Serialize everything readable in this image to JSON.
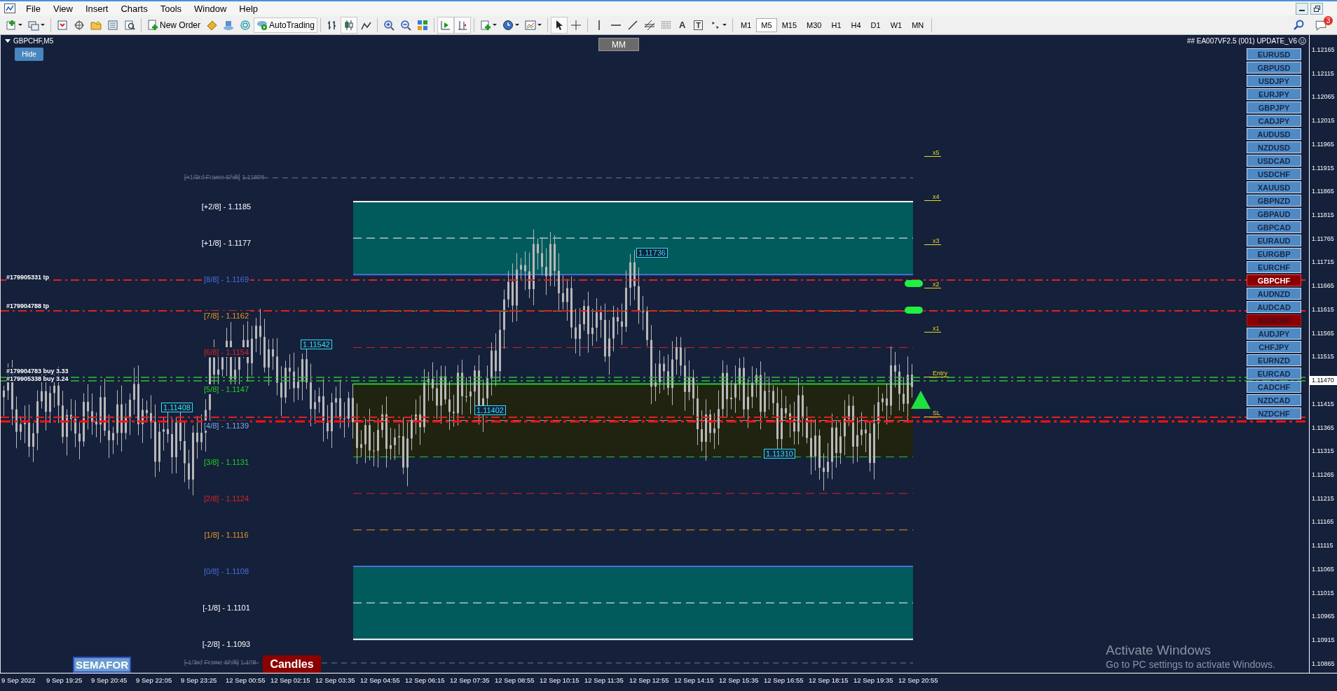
{
  "menu": [
    {
      "label": "File"
    },
    {
      "label": "View"
    },
    {
      "label": "Insert"
    },
    {
      "label": "Charts"
    },
    {
      "label": "Tools"
    },
    {
      "label": "Window"
    },
    {
      "label": "Help"
    }
  ],
  "toolbar": {
    "new_order": "New Order",
    "auto_trading": "AutoTrading",
    "text_tool": "A",
    "text_label_tool": "T",
    "notification_count": "3",
    "timeframes": [
      {
        "label": "M1",
        "selected": false
      },
      {
        "label": "M5",
        "selected": true
      },
      {
        "label": "M15",
        "selected": false
      },
      {
        "label": "M30",
        "selected": false
      },
      {
        "label": "H1",
        "selected": false
      },
      {
        "label": "H4",
        "selected": false
      },
      {
        "label": "D1",
        "selected": false
      },
      {
        "label": "W1",
        "selected": false
      },
      {
        "label": "MN",
        "selected": false
      }
    ]
  },
  "chart": {
    "symbol": "GBPCHF,M5",
    "hide_button": "Hide",
    "mm_button": "MM",
    "expert": "## EA007VF2.5 (001) UPDATE_V6",
    "frame_shift_top": "[+1/3rd Frame Shift]  1.11898",
    "frame_shift_bottom": "[-1/3rd Frame Shift]  1.108",
    "murrey_levels": [
      {
        "label": "[+2/8] - 1.1185",
        "color": "#ffffff"
      },
      {
        "label": "[+1/8] - 1.1177",
        "color": "#ffffff"
      },
      {
        "label": "[8/8] - 1.1169",
        "color": "#4a6fd8"
      },
      {
        "label": "[7/8] - 1.1162",
        "color": "#e69a1c"
      },
      {
        "label": "[6/8] - 1.1154",
        "color": "#e02020"
      },
      {
        "label": "[5/8] - 1.1147",
        "color": "#20d020"
      },
      {
        "label": "[4/8] - 1.1139",
        "color": "#7aa8e0"
      },
      {
        "label": "[3/8] - 1.1131",
        "color": "#20d020"
      },
      {
        "label": "[2/8] - 1.1124",
        "color": "#e02020"
      },
      {
        "label": "[1/8] - 1.1116",
        "color": "#e69a1c"
      },
      {
        "label": "[0/8] - 1.1108",
        "color": "#4a6fd8"
      },
      {
        "label": "[-1/8] - 1.1101",
        "color": "#ffffff"
      },
      {
        "label": "[-2/8] - 1.1093",
        "color": "#ffffff"
      }
    ],
    "order_labels": [
      {
        "label": "#179905331 tp"
      },
      {
        "label": "#179904788 tp"
      },
      {
        "label": "#179904783 buy 3.33"
      },
      {
        "label": "#179905338 buy 3.24"
      }
    ],
    "price_tags": [
      {
        "label": "1.11736"
      },
      {
        "label": "1.11542"
      },
      {
        "label": "1.11408"
      },
      {
        "label": "1.11402"
      },
      {
        "label": "1.11310"
      }
    ],
    "targets": [
      {
        "label": "x5"
      },
      {
        "label": "x4"
      },
      {
        "label": "x3"
      },
      {
        "label": "x2"
      },
      {
        "label": "x1"
      },
      {
        "label": "Entry"
      },
      {
        "label": "SL"
      }
    ],
    "semafor_button": "SEMAFOR",
    "candles_button": "Candles"
  },
  "symbols": [
    {
      "label": "EURUSD",
      "selected": false,
      "marked": false
    },
    {
      "label": "GBPUSD",
      "selected": false,
      "marked": false
    },
    {
      "label": "USDJPY",
      "selected": false,
      "marked": false
    },
    {
      "label": "EURJPY",
      "selected": false,
      "marked": false
    },
    {
      "label": "GBPJPY",
      "selected": false,
      "marked": false
    },
    {
      "label": "CADJPY",
      "selected": false,
      "marked": false
    },
    {
      "label": "AUDUSD",
      "selected": false,
      "marked": false
    },
    {
      "label": "NZDUSD",
      "selected": false,
      "marked": false
    },
    {
      "label": "USDCAD",
      "selected": false,
      "marked": false
    },
    {
      "label": "USDCHF",
      "selected": false,
      "marked": false
    },
    {
      "label": "XAUUSD",
      "selected": false,
      "marked": false
    },
    {
      "label": "GBPNZD",
      "selected": false,
      "marked": false
    },
    {
      "label": "GBPAUD",
      "selected": false,
      "marked": false
    },
    {
      "label": "GBPCAD",
      "selected": false,
      "marked": false
    },
    {
      "label": "EURAUD",
      "selected": false,
      "marked": false
    },
    {
      "label": "EURGBP",
      "selected": false,
      "marked": false
    },
    {
      "label": "EURCHF",
      "selected": false,
      "marked": false
    },
    {
      "label": "GBPCHF",
      "selected": true,
      "marked": false
    },
    {
      "label": "AUDNZD",
      "selected": false,
      "marked": false
    },
    {
      "label": "AUDCAD",
      "selected": false,
      "marked": false
    },
    {
      "label": "AUDCHF",
      "selected": false,
      "marked": true
    },
    {
      "label": "AUDJPY",
      "selected": false,
      "marked": false
    },
    {
      "label": "CHFJPY",
      "selected": false,
      "marked": false
    },
    {
      "label": "EURNZD",
      "selected": false,
      "marked": false
    },
    {
      "label": "EURCAD",
      "selected": false,
      "marked": false
    },
    {
      "label": "CADCHF",
      "selected": false,
      "marked": false
    },
    {
      "label": "NZDCAD",
      "selected": false,
      "marked": false
    },
    {
      "label": "NZDCHF",
      "selected": false,
      "marked": false
    }
  ],
  "price_axis": [
    {
      "label": "1.12165",
      "current": false
    },
    {
      "label": "1.12115",
      "current": false
    },
    {
      "label": "1.12065",
      "current": false
    },
    {
      "label": "1.12015",
      "current": false
    },
    {
      "label": "1.11965",
      "current": false
    },
    {
      "label": "1.11915",
      "current": false
    },
    {
      "label": "1.11865",
      "current": false
    },
    {
      "label": "1.11815",
      "current": false
    },
    {
      "label": "1.11765",
      "current": false
    },
    {
      "label": "1.11715",
      "current": false
    },
    {
      "label": "1.11665",
      "current": false
    },
    {
      "label": "1.11615",
      "current": false
    },
    {
      "label": "1.11565",
      "current": false
    },
    {
      "label": "1.11515",
      "current": false
    },
    {
      "label": "1.11470",
      "current": true
    },
    {
      "label": "1.11415",
      "current": false
    },
    {
      "label": "1.11365",
      "current": false
    },
    {
      "label": "1.11315",
      "current": false
    },
    {
      "label": "1.11265",
      "current": false
    },
    {
      "label": "1.11215",
      "current": false
    },
    {
      "label": "1.11165",
      "current": false
    },
    {
      "label": "1.11115",
      "current": false
    },
    {
      "label": "1.11065",
      "current": false
    },
    {
      "label": "1.11015",
      "current": false
    },
    {
      "label": "1.10965",
      "current": false
    },
    {
      "label": "1.10915",
      "current": false
    },
    {
      "label": "1.10865",
      "current": false
    }
  ],
  "time_axis": [
    "9 Sep 2022",
    "9 Sep 19:25",
    "9 Sep 20:45",
    "9 Sep 22:05",
    "9 Sep 23:25",
    "12 Sep 00:55",
    "12 Sep 02:15",
    "12 Sep 03:35",
    "12 Sep 04:55",
    "12 Sep 06:15",
    "12 Sep 07:35",
    "12 Sep 08:55",
    "12 Sep 10:15",
    "12 Sep 11:35",
    "12 Sep 12:55",
    "12 Sep 14:15",
    "12 Sep 15:35",
    "12 Sep 16:55",
    "12 Sep 18:15",
    "12 Sep 19:35",
    "12 Sep 20:55"
  ],
  "os_notice": {
    "title": "Activate Windows",
    "text": "Go to PC settings to activate Windows."
  }
}
